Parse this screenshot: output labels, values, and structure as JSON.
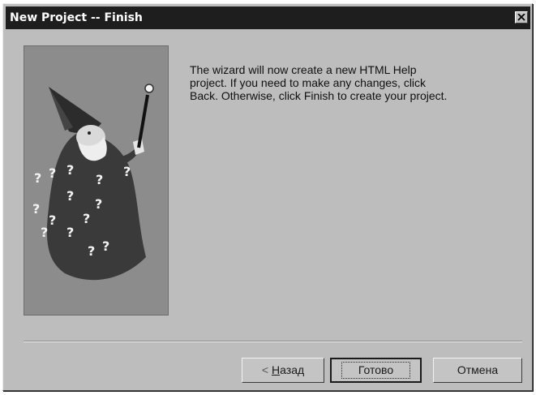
{
  "window": {
    "title": "New Project -- Finish"
  },
  "message": {
    "line1": "The wizard will now create a new HTML Help",
    "line2": "project. If you need to make any changes, click",
    "line3": "Back. Otherwise, click Finish to create your project."
  },
  "buttons": {
    "back_arrow": "<",
    "back_accel": "Н",
    "back_rest": "азад",
    "finish_label": "Готово",
    "cancel_label": "Отмена"
  },
  "image": {
    "marks": [
      "?",
      "?",
      "?",
      "?",
      "?",
      "?",
      "?",
      "?",
      "?",
      "?",
      "?",
      "?",
      "?",
      "?"
    ]
  },
  "colors": {
    "titlebar": "#1e1e1e",
    "dialog": "#bdbdbd",
    "image_bg": "#8c8c8c"
  }
}
